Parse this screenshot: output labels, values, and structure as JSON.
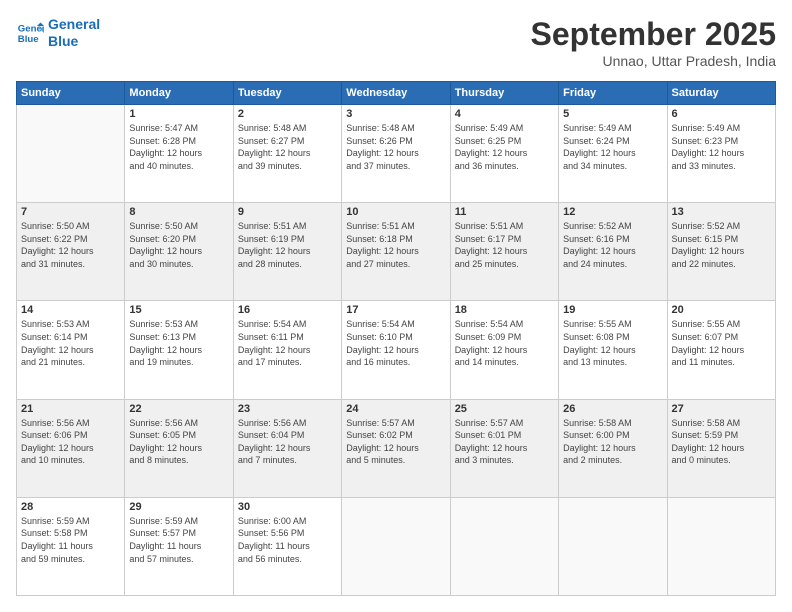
{
  "logo": {
    "line1": "General",
    "line2": "Blue"
  },
  "title": "September 2025",
  "subtitle": "Unnao, Uttar Pradesh, India",
  "weekdays": [
    "Sunday",
    "Monday",
    "Tuesday",
    "Wednesday",
    "Thursday",
    "Friday",
    "Saturday"
  ],
  "weeks": [
    [
      {
        "day": "",
        "info": ""
      },
      {
        "day": "1",
        "info": "Sunrise: 5:47 AM\nSunset: 6:28 PM\nDaylight: 12 hours\nand 40 minutes."
      },
      {
        "day": "2",
        "info": "Sunrise: 5:48 AM\nSunset: 6:27 PM\nDaylight: 12 hours\nand 39 minutes."
      },
      {
        "day": "3",
        "info": "Sunrise: 5:48 AM\nSunset: 6:26 PM\nDaylight: 12 hours\nand 37 minutes."
      },
      {
        "day": "4",
        "info": "Sunrise: 5:49 AM\nSunset: 6:25 PM\nDaylight: 12 hours\nand 36 minutes."
      },
      {
        "day": "5",
        "info": "Sunrise: 5:49 AM\nSunset: 6:24 PM\nDaylight: 12 hours\nand 34 minutes."
      },
      {
        "day": "6",
        "info": "Sunrise: 5:49 AM\nSunset: 6:23 PM\nDaylight: 12 hours\nand 33 minutes."
      }
    ],
    [
      {
        "day": "7",
        "info": "Sunrise: 5:50 AM\nSunset: 6:22 PM\nDaylight: 12 hours\nand 31 minutes."
      },
      {
        "day": "8",
        "info": "Sunrise: 5:50 AM\nSunset: 6:20 PM\nDaylight: 12 hours\nand 30 minutes."
      },
      {
        "day": "9",
        "info": "Sunrise: 5:51 AM\nSunset: 6:19 PM\nDaylight: 12 hours\nand 28 minutes."
      },
      {
        "day": "10",
        "info": "Sunrise: 5:51 AM\nSunset: 6:18 PM\nDaylight: 12 hours\nand 27 minutes."
      },
      {
        "day": "11",
        "info": "Sunrise: 5:51 AM\nSunset: 6:17 PM\nDaylight: 12 hours\nand 25 minutes."
      },
      {
        "day": "12",
        "info": "Sunrise: 5:52 AM\nSunset: 6:16 PM\nDaylight: 12 hours\nand 24 minutes."
      },
      {
        "day": "13",
        "info": "Sunrise: 5:52 AM\nSunset: 6:15 PM\nDaylight: 12 hours\nand 22 minutes."
      }
    ],
    [
      {
        "day": "14",
        "info": "Sunrise: 5:53 AM\nSunset: 6:14 PM\nDaylight: 12 hours\nand 21 minutes."
      },
      {
        "day": "15",
        "info": "Sunrise: 5:53 AM\nSunset: 6:13 PM\nDaylight: 12 hours\nand 19 minutes."
      },
      {
        "day": "16",
        "info": "Sunrise: 5:54 AM\nSunset: 6:11 PM\nDaylight: 12 hours\nand 17 minutes."
      },
      {
        "day": "17",
        "info": "Sunrise: 5:54 AM\nSunset: 6:10 PM\nDaylight: 12 hours\nand 16 minutes."
      },
      {
        "day": "18",
        "info": "Sunrise: 5:54 AM\nSunset: 6:09 PM\nDaylight: 12 hours\nand 14 minutes."
      },
      {
        "day": "19",
        "info": "Sunrise: 5:55 AM\nSunset: 6:08 PM\nDaylight: 12 hours\nand 13 minutes."
      },
      {
        "day": "20",
        "info": "Sunrise: 5:55 AM\nSunset: 6:07 PM\nDaylight: 12 hours\nand 11 minutes."
      }
    ],
    [
      {
        "day": "21",
        "info": "Sunrise: 5:56 AM\nSunset: 6:06 PM\nDaylight: 12 hours\nand 10 minutes."
      },
      {
        "day": "22",
        "info": "Sunrise: 5:56 AM\nSunset: 6:05 PM\nDaylight: 12 hours\nand 8 minutes."
      },
      {
        "day": "23",
        "info": "Sunrise: 5:56 AM\nSunset: 6:04 PM\nDaylight: 12 hours\nand 7 minutes."
      },
      {
        "day": "24",
        "info": "Sunrise: 5:57 AM\nSunset: 6:02 PM\nDaylight: 12 hours\nand 5 minutes."
      },
      {
        "day": "25",
        "info": "Sunrise: 5:57 AM\nSunset: 6:01 PM\nDaylight: 12 hours\nand 3 minutes."
      },
      {
        "day": "26",
        "info": "Sunrise: 5:58 AM\nSunset: 6:00 PM\nDaylight: 12 hours\nand 2 minutes."
      },
      {
        "day": "27",
        "info": "Sunrise: 5:58 AM\nSunset: 5:59 PM\nDaylight: 12 hours\nand 0 minutes."
      }
    ],
    [
      {
        "day": "28",
        "info": "Sunrise: 5:59 AM\nSunset: 5:58 PM\nDaylight: 11 hours\nand 59 minutes."
      },
      {
        "day": "29",
        "info": "Sunrise: 5:59 AM\nSunset: 5:57 PM\nDaylight: 11 hours\nand 57 minutes."
      },
      {
        "day": "30",
        "info": "Sunrise: 6:00 AM\nSunset: 5:56 PM\nDaylight: 11 hours\nand 56 minutes."
      },
      {
        "day": "",
        "info": ""
      },
      {
        "day": "",
        "info": ""
      },
      {
        "day": "",
        "info": ""
      },
      {
        "day": "",
        "info": ""
      }
    ]
  ]
}
